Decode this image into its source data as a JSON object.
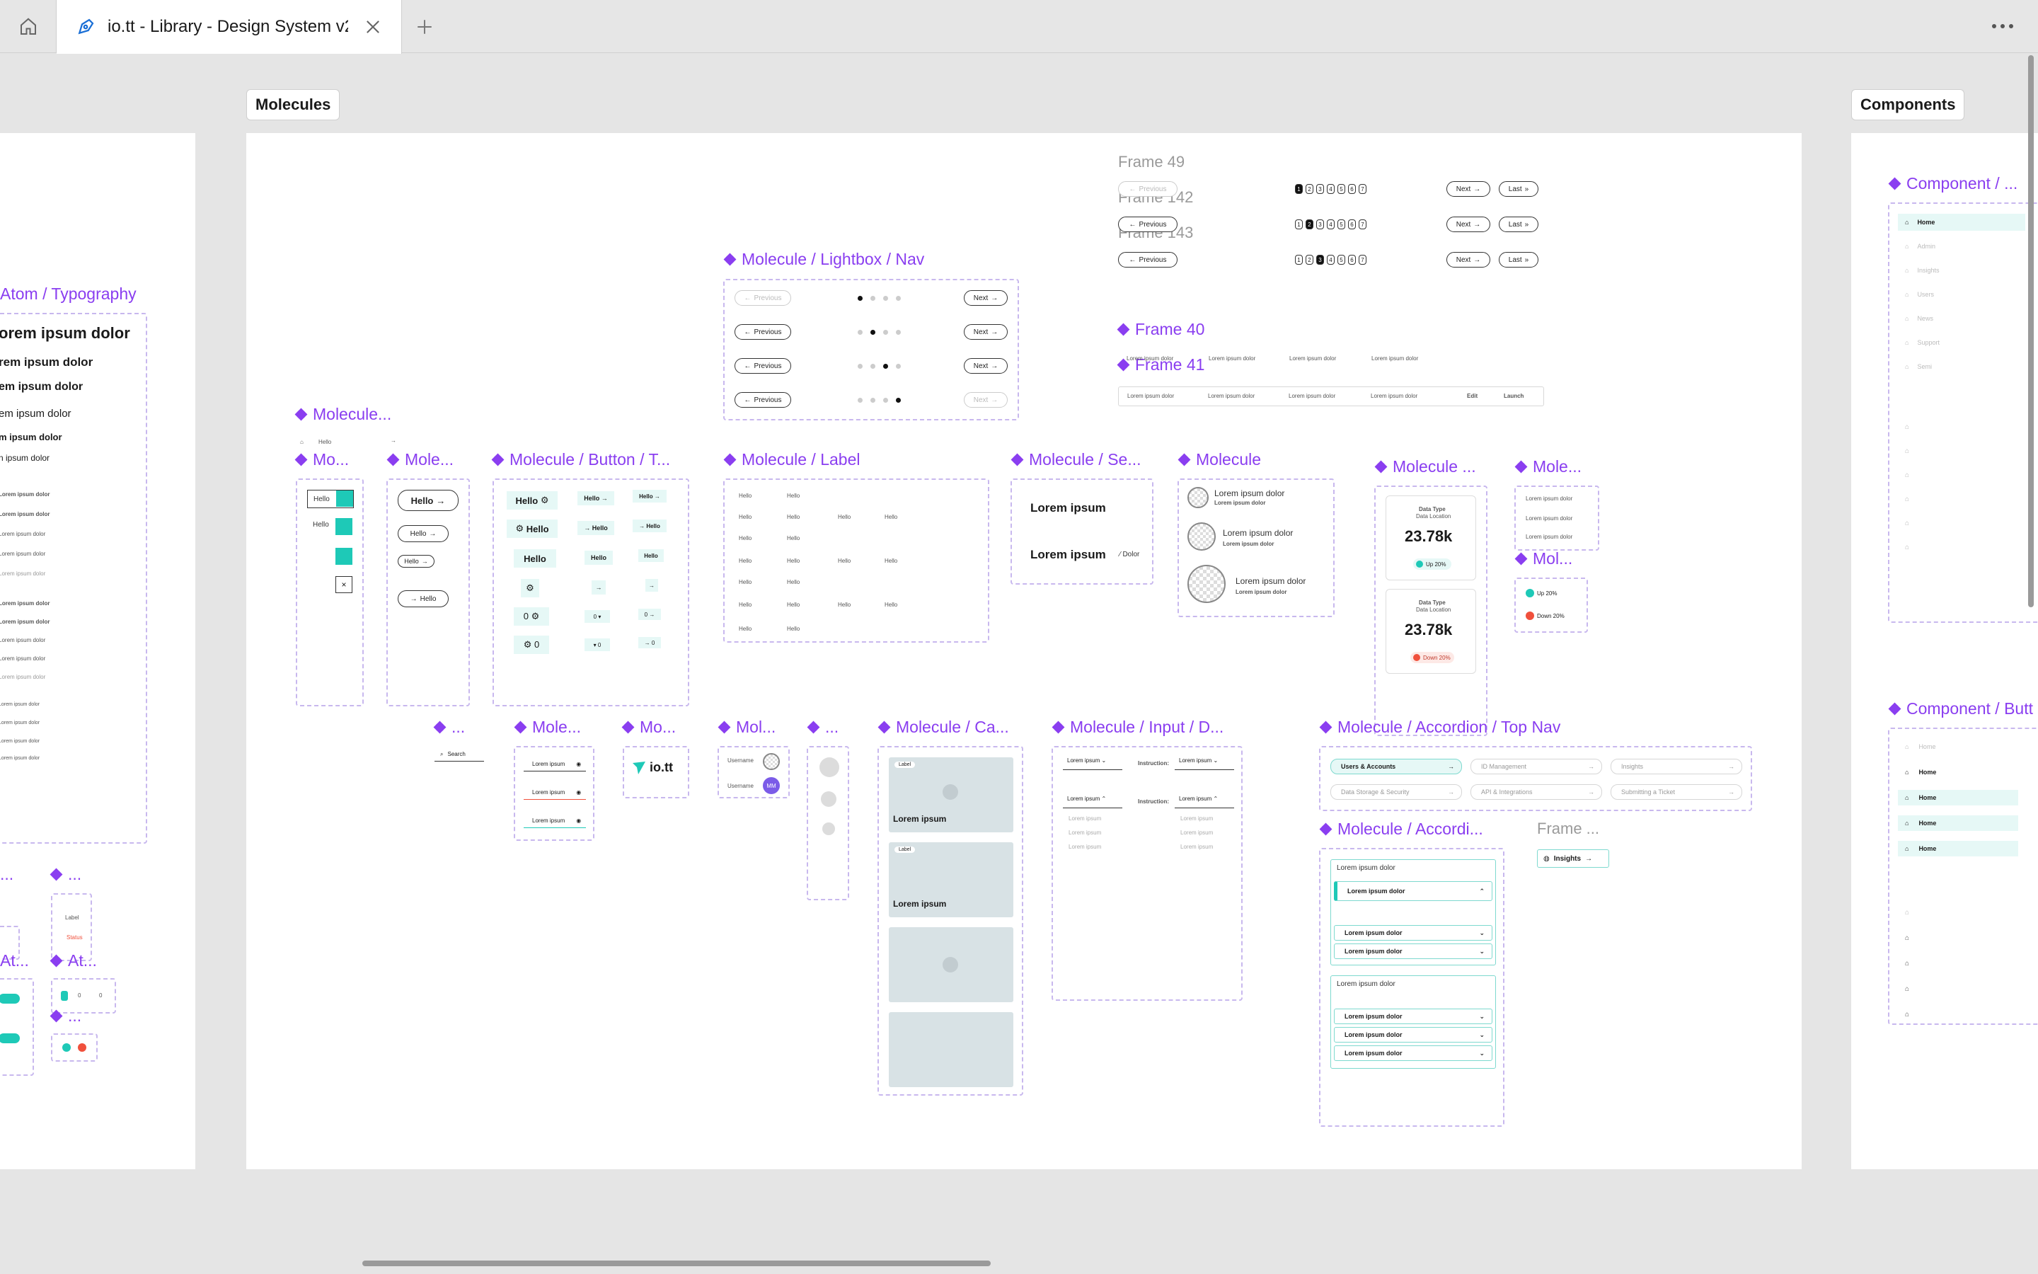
{
  "tabbar": {
    "tab_title": "io.tt - Library - Design System v2",
    "home_icon": "home-icon",
    "tab_icon": "figma-pen-icon",
    "close_icon": "close-icon",
    "new_tab_icon": "plus-icon",
    "menu_icon": "more-dots-icon"
  },
  "canvas": {
    "molecules_label": "Molecules",
    "components_label": "Components"
  },
  "components": {
    "atom_typography": "Atom / Typography",
    "typo_samples": [
      "orem ipsum dolor",
      "rem ipsum dolor",
      "em ipsum dolor",
      "em ipsum dolor",
      "m ipsum dolor",
      "n ipsum dolor"
    ],
    "lightbox_nav": "Molecule / Lightbox / Nav",
    "molecule_short": "Molecule...",
    "mo": "Mo...",
    "mole": "Mole...",
    "button_t": "Molecule / Button / T...",
    "label": "Molecule / Label",
    "se": "Molecule / Se...",
    "molecule": "Molecule",
    "molecule_dots": "Molecule ...",
    "mole_right": "Mole...",
    "mol_small": "Mol...",
    "ca": "Molecule / Ca...",
    "input_d": "Molecule / Input / D...",
    "accordion_top_nav": "Molecule / Accordion / Top Nav",
    "accordi": "Molecule / Accordi...",
    "frame_dots": "Frame ...",
    "component_short": "Component / ...",
    "component_butt": "Component / Butt",
    "ellipsis": "...",
    "at": "At...",
    "frame49": "Frame 49",
    "frame142": "Frame 142",
    "frame143": "Frame 143",
    "frame40": "Frame 40",
    "frame41": "Frame 41"
  },
  "texts": {
    "previous": "Previous",
    "next": "Next",
    "last": "Last",
    "hello": "Hello",
    "lorem_ipsum": "Lorem ipsum",
    "lorem_ipsum_dolor": "Lorem ipsum dolor",
    "dolor": "Dolor",
    "data_type": "Data Type",
    "data_location": "Data Location",
    "stat_value": "23.78k",
    "up": "Up 20%",
    "down": "Down 20%",
    "search": "Search",
    "brand": "io.tt",
    "username": "Username",
    "avatar_initials": "MM",
    "label": "Label",
    "instruction": "Instruction:",
    "insights": "Insights",
    "edit": "Edit",
    "launch": "Launch",
    "status": "Status",
    "home": "Home"
  },
  "accordion_top_nav": [
    "Users & Accounts",
    "ID Management",
    "Insights",
    "Data Storage & Security",
    "API & Integrations",
    "Submitting a Ticket"
  ],
  "side_nav": [
    "Home",
    "Admin",
    "Insights",
    "Users",
    "News",
    "Support",
    "Semi"
  ],
  "pagination_numbers": [
    "1",
    "2",
    "3",
    "4",
    "5",
    "6",
    "7"
  ],
  "colors": {
    "accent_purple": "#8a3ef0",
    "teal": "#1ec9b7",
    "red": "#f0503c"
  }
}
